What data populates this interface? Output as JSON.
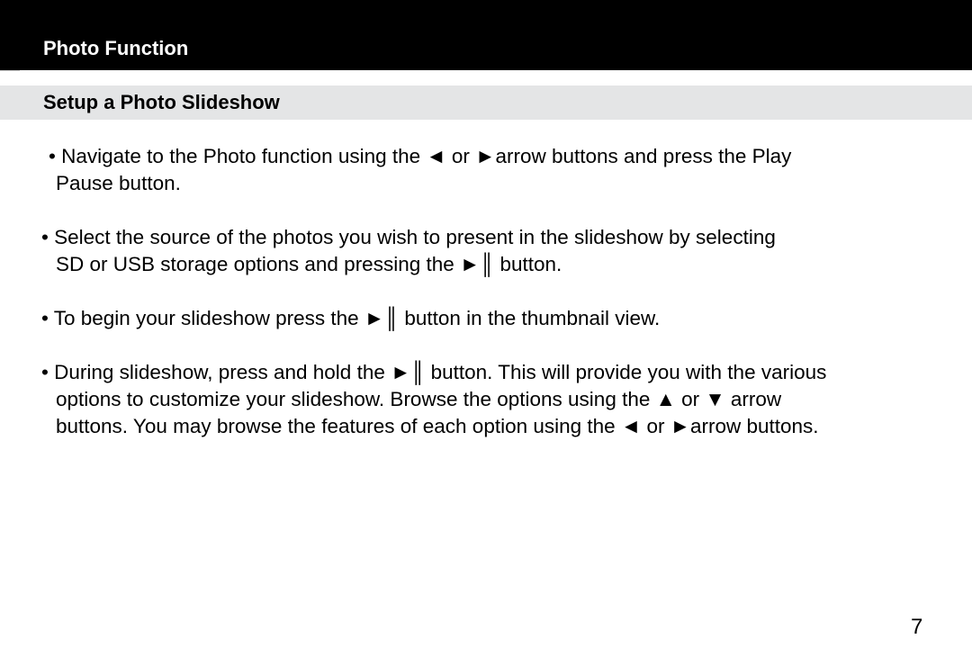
{
  "header": {
    "title": "Photo Function",
    "background_color": "#000000",
    "text_color": "#ffffff"
  },
  "section": {
    "title": "Setup a Photo Slideshow",
    "band_color": "#e4e5e6"
  },
  "bullets": [
    {
      "lines": [
        "• Navigate to the Photo function using the ◄ or ►arrow buttons and press the Play",
        "Pause button."
      ]
    },
    {
      "lines": [
        "• Select the source of the photos you wish to present in the slideshow by selecting",
        "SD or USB storage options and pressing the ►║ button."
      ]
    },
    {
      "lines": [
        "• To begin your slideshow press the ►║ button in the thumbnail view."
      ]
    },
    {
      "lines": [
        "• During slideshow, press and hold the ►║ button.  This will provide you with the various",
        "options to customize your slideshow.  Browse the options using the ▲ or ▼ arrow",
        "buttons.  You may browse the features of each option using the ◄ or ►arrow buttons."
      ]
    }
  ],
  "footer": {
    "page_number": "7"
  }
}
